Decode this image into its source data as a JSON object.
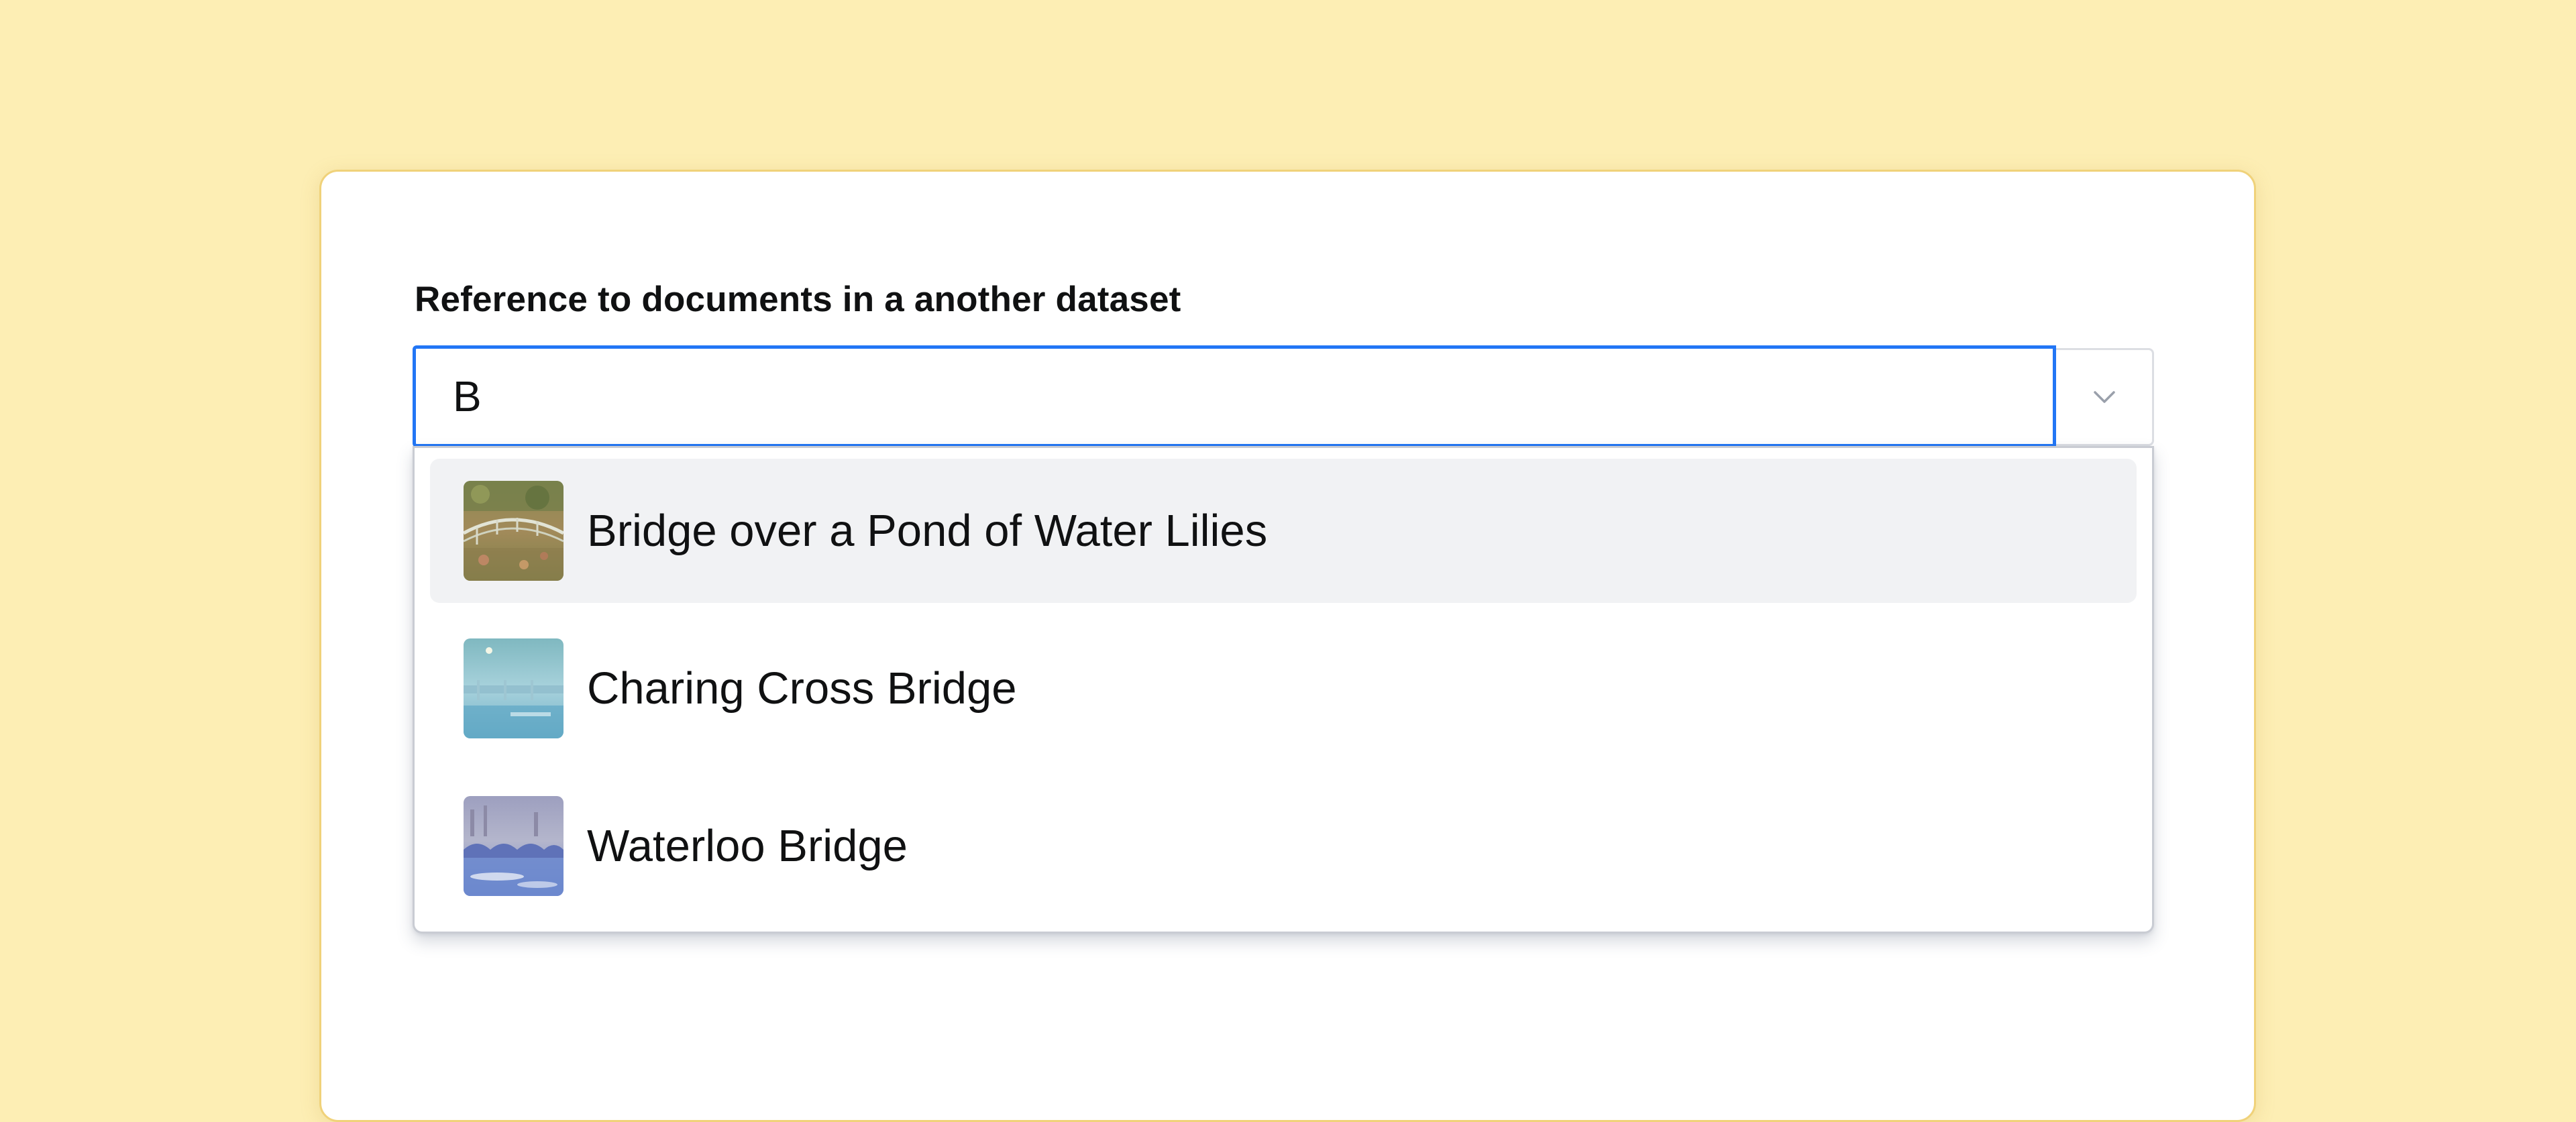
{
  "field": {
    "label": "Reference to documents in a another dataset",
    "value": "B"
  },
  "toggle": {
    "icon": "chevron-down-icon"
  },
  "options": [
    {
      "label": "Bridge over a Pond of Water Lilies",
      "thumbnail": "water-lilies-bridge-painting",
      "highlighted": true
    },
    {
      "label": "Charing Cross Bridge",
      "thumbnail": "charing-cross-bridge-painting",
      "highlighted": false
    },
    {
      "label": "Waterloo Bridge",
      "thumbnail": "waterloo-bridge-painting",
      "highlighted": false
    }
  ],
  "colors": {
    "background": "#fdeeb4",
    "card": "#ffffff",
    "focus_border": "#2276f5",
    "highlight": "#f1f2f4",
    "text": "#101112"
  }
}
